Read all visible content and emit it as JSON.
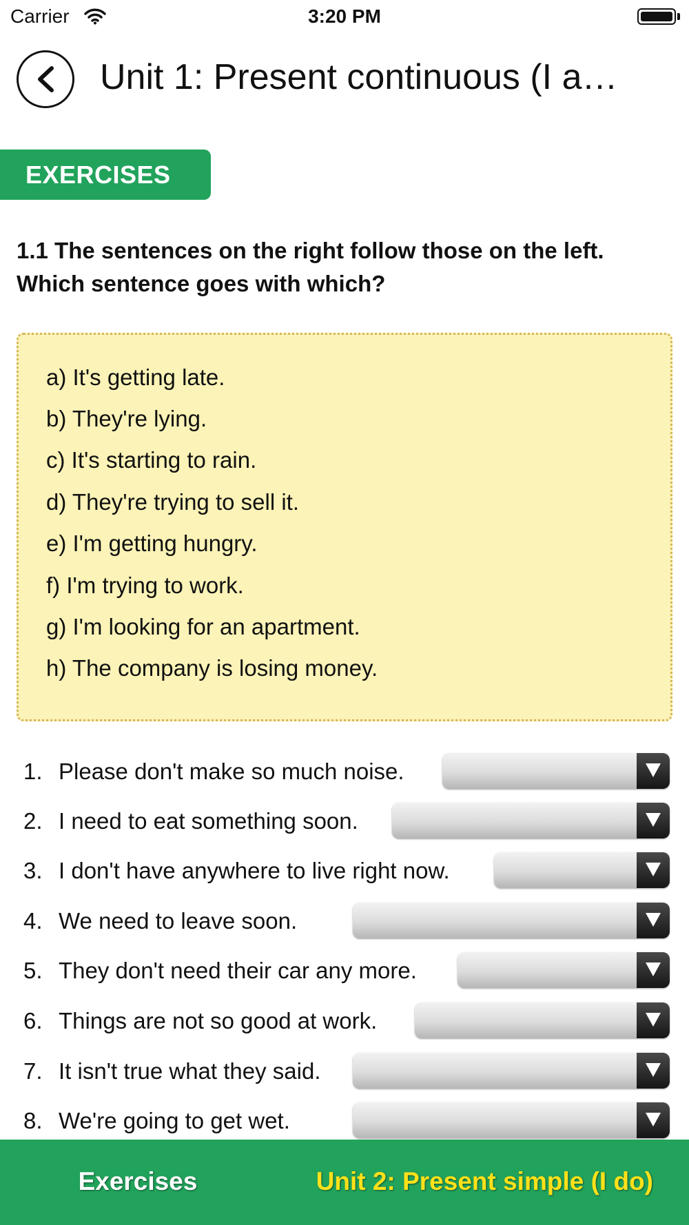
{
  "status_bar": {
    "carrier": "Carrier",
    "time": "3:20 PM"
  },
  "header": {
    "title": "Unit 1: Present continuous (I a…"
  },
  "section_tab": {
    "label": "EXERCISES"
  },
  "exercise": {
    "question": "1.1 The sentences on the right follow those on the left. Which sentence goes with which?",
    "options": [
      "a) It's getting late.",
      "b) They're lying.",
      "c) It's starting to rain.",
      "d) They're trying to sell it.",
      "e) I'm getting hungry.",
      "f) I'm trying to work.",
      "g) I'm looking for an apartment.",
      "h) The company is losing money."
    ],
    "items": [
      {
        "number": "1.",
        "text": "Please don't make so much noise.",
        "selected": ""
      },
      {
        "number": "2.",
        "text": "I need to eat something soon.",
        "selected": ""
      },
      {
        "number": "3.",
        "text": "I don't have anywhere to live right now.",
        "selected": ""
      },
      {
        "number": "4.",
        "text": "We need to leave soon.",
        "selected": ""
      },
      {
        "number": "5.",
        "text": "They don't need their car any more.",
        "selected": ""
      },
      {
        "number": "6.",
        "text": "Things are not so good at work.",
        "selected": ""
      },
      {
        "number": "7.",
        "text": "It isn't true what they said.",
        "selected": ""
      },
      {
        "number": "8.",
        "text": "We're going to get wet.",
        "selected": ""
      }
    ]
  },
  "bottom_bar": {
    "left_label": "Exercises",
    "right_label": "Unit 2: Present simple (I do)"
  },
  "colors": {
    "accent_green": "#21a35c",
    "option_box_bg": "#fbf3b7",
    "next_unit_yellow": "#ffe11a"
  }
}
